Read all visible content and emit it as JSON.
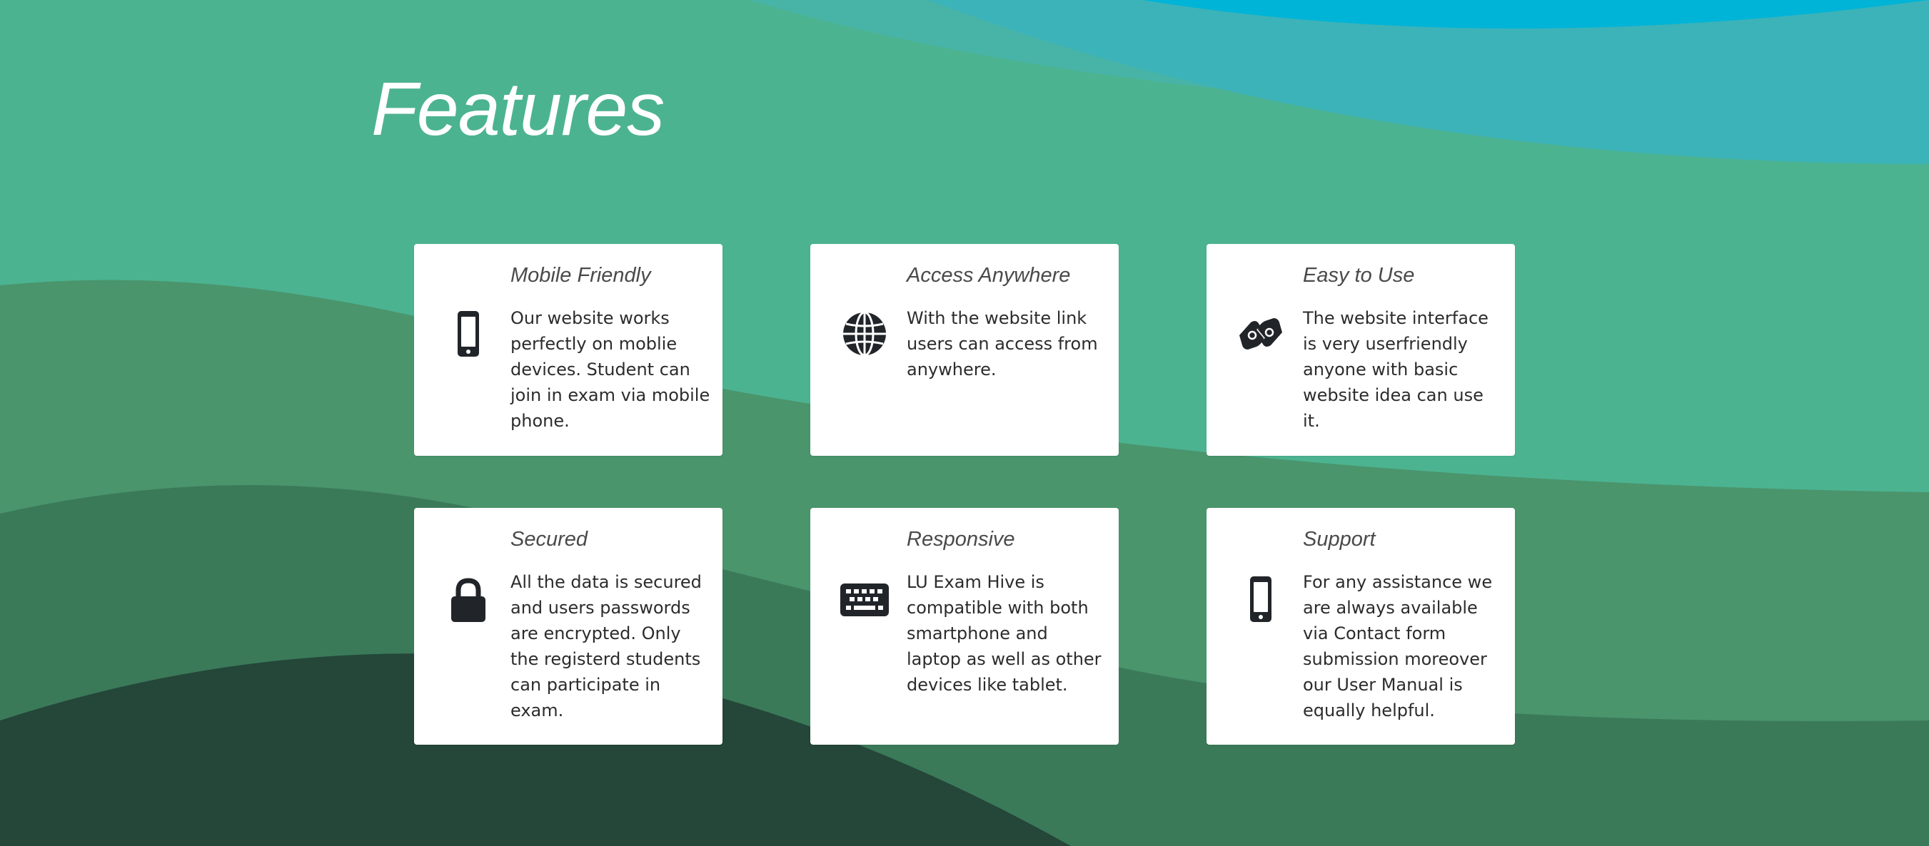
{
  "section": {
    "title": "Features"
  },
  "features": [
    {
      "title": "Mobile Friendly",
      "description": "Our website works perfectly on moblie devices. Student can join in exam via mobile phone.",
      "icon": "mobile-phone-icon"
    },
    {
      "title": "Access Anywhere",
      "description": "With the website link users can access from anywhere.",
      "icon": "globe-icon"
    },
    {
      "title": "Easy to Use",
      "description": "The website interface is very userfriendly anyone with basic website idea can use it.",
      "icon": "sign-language-hands-icon"
    },
    {
      "title": "Secured",
      "description": "All the data is secured and users passwords are encrypted. Only the registerd students can participate in exam.",
      "icon": "lock-icon"
    },
    {
      "title": "Responsive",
      "description": "LU Exam Hive is compatible with both smartphone and laptop as well as other devices like tablet.",
      "icon": "keyboard-icon"
    },
    {
      "title": "Support",
      "description": "For any assistance we are always available via Contact form submission moreover our User Manual is equally helpful.",
      "icon": "mobile-phone-icon"
    }
  ],
  "colors": {
    "card_bg": "#ffffff",
    "icon": "#212529",
    "heading_text": "#4a4a4a",
    "body_text": "#2c2c2c",
    "wave_dark": "#24473a",
    "wave_green": "#52b788",
    "wave_blue": "#00b4d8"
  }
}
